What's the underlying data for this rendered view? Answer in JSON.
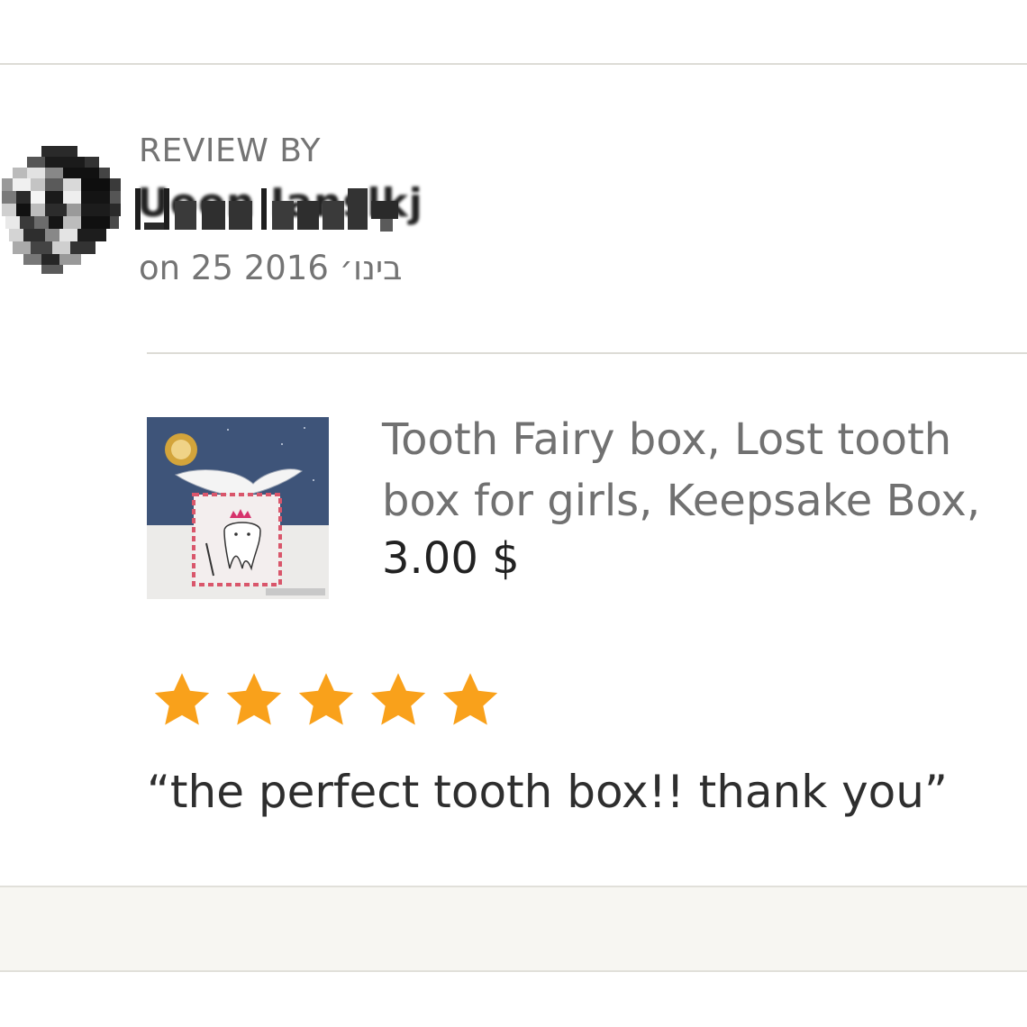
{
  "review": {
    "heading": "REVIEW BY",
    "reviewer_name": "Uoon Ianslkj",
    "date": "on 25 בינו׳ 2016",
    "rating": 5,
    "rating_max": 5,
    "quote": "“the perfect tooth box!! thank you”"
  },
  "product": {
    "title_line1": "Tooth Fairy box, Lost tooth",
    "title_line2": "box for girls, Keepsake Box,",
    "price": "3.00 $"
  },
  "colors": {
    "star": "#f9a11b",
    "divider": "#dddcd6",
    "footer_band": "#f7f6f2"
  },
  "icons": {
    "avatar": "pixelated-avatar-icon",
    "star": "star-icon"
  }
}
